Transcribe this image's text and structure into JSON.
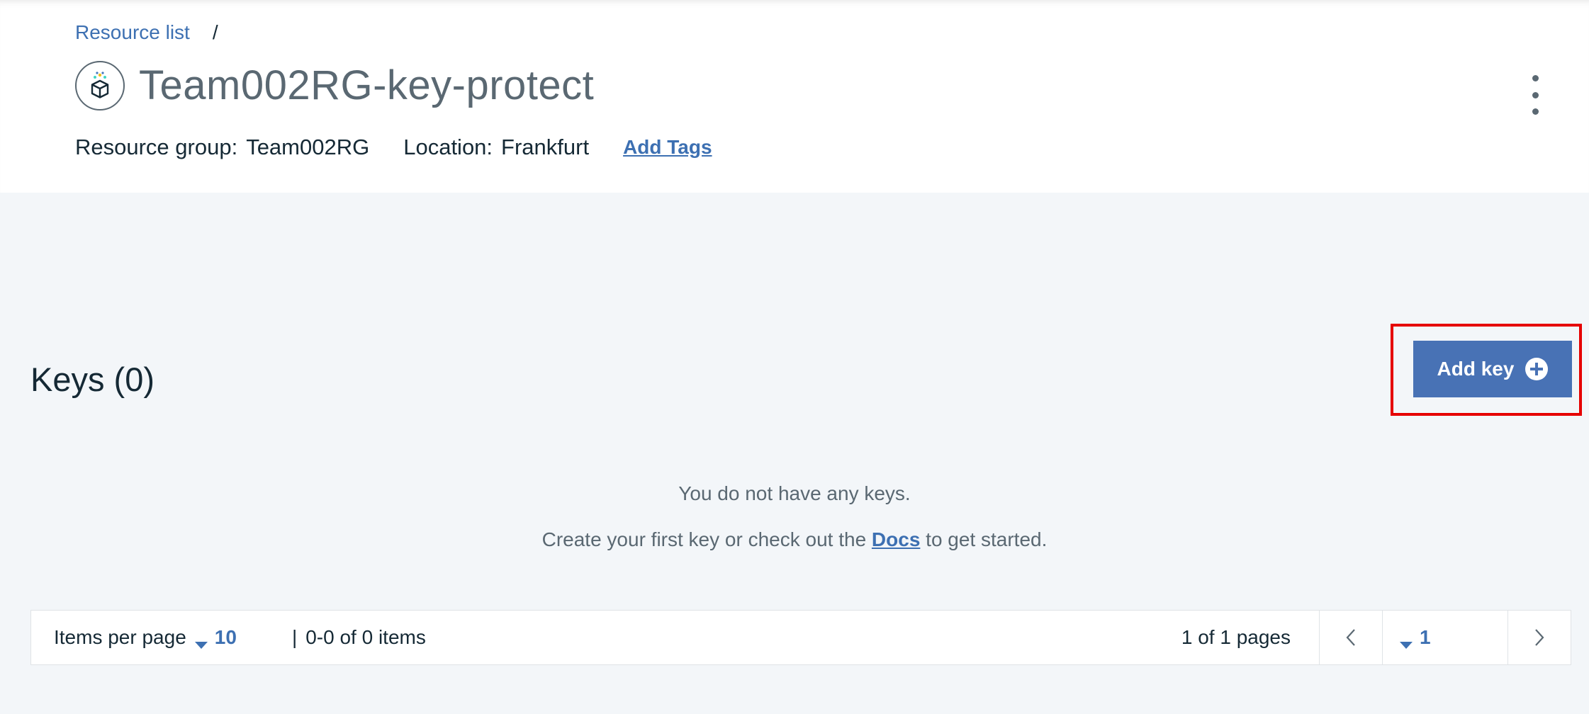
{
  "breadcrumb": {
    "link": "Resource list",
    "separator": "/"
  },
  "header": {
    "icon": "key-protect-service-icon",
    "title": "Team002RG-key-protect",
    "menu_icon": "overflow-menu-icon"
  },
  "meta": {
    "resource_group_label": "Resource group:",
    "resource_group_value": "Team002RG",
    "location_label": "Location:",
    "location_value": "Frankfurt",
    "add_tags": "Add Tags"
  },
  "keys": {
    "title": "Keys (0)",
    "add_key_label": "Add key",
    "add_key_icon": "add-circle-icon"
  },
  "empty_state": {
    "line1": "You do not have any keys.",
    "line2_before": "Create your first key or check out the",
    "docs_link": "Docs",
    "line2_after": "to get started."
  },
  "pagination": {
    "items_per_page_label": "Items per page",
    "items_per_page_value": "10",
    "separator": "|",
    "range_text": "0-0 of 0 items",
    "pages_text": "1 of 1 pages",
    "current_page": "1"
  },
  "colors": {
    "accent": "#3d70b2",
    "button": "#4872b5",
    "highlight": "#e60000",
    "background": "#f3f6f9"
  }
}
